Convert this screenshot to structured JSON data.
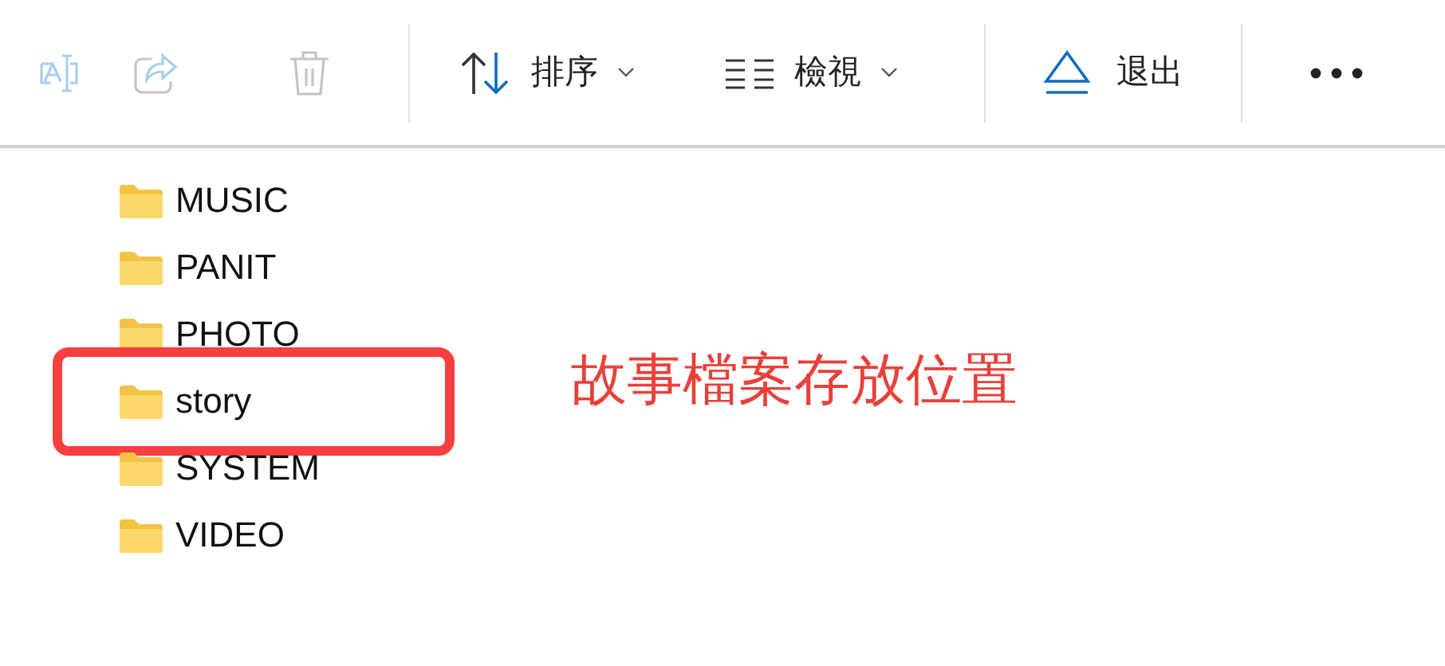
{
  "toolbar": [
    {
      "kind": "rename",
      "disabled": true
    },
    {
      "kind": "share",
      "disabled": true
    },
    {
      "kind": "delete",
      "disabled": true
    },
    {
      "kind": "divider"
    },
    {
      "kind": "sort",
      "label": "排序"
    },
    {
      "kind": "view",
      "label": "檢視"
    },
    {
      "kind": "divider"
    },
    {
      "kind": "eject",
      "label": "退出"
    },
    {
      "kind": "divider"
    },
    {
      "kind": "more"
    }
  ],
  "folders": [
    {
      "name": "MUSIC",
      "highlighted": false
    },
    {
      "name": "PANIT",
      "highlighted": false
    },
    {
      "name": "PHOTO",
      "highlighted": false
    },
    {
      "name": "story",
      "highlighted": true
    },
    {
      "name": "SYSTEM",
      "highlighted": false
    },
    {
      "name": "VIDEO",
      "highlighted": false
    }
  ],
  "annotation": {
    "text": "故事檔案存放位置"
  }
}
